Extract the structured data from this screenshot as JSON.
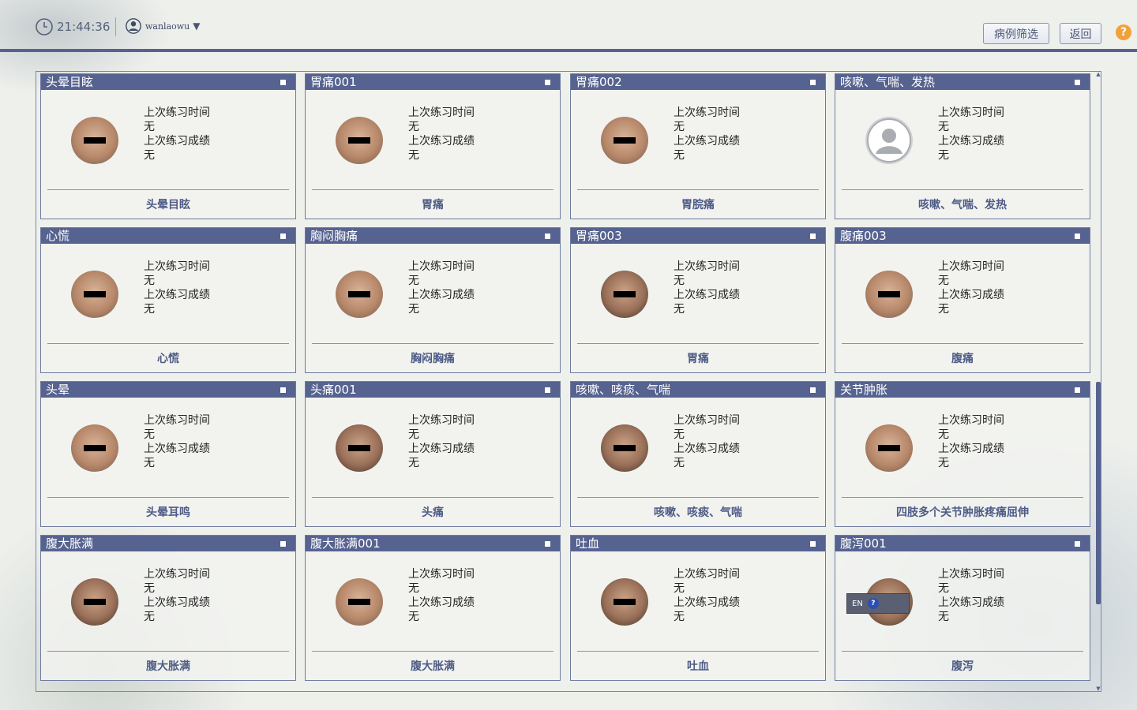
{
  "header": {
    "time": "21:44:36",
    "username": "wanlaowu",
    "filter_button": "病例筛选",
    "back_button": "返回",
    "help_label": "?"
  },
  "info_labels": {
    "last_time_label": "上次练习时间",
    "last_score_label": "上次练习成绩"
  },
  "cards": [
    {
      "title": "头晕目眩",
      "last_time": "无",
      "last_score": "无",
      "footer": "头晕目眩"
    },
    {
      "title": "胃痛001",
      "last_time": "无",
      "last_score": "无",
      "footer": "胃痛"
    },
    {
      "title": "胃痛002",
      "last_time": "无",
      "last_score": "无",
      "footer": "胃脘痛"
    },
    {
      "title": "咳嗽、气喘、发热",
      "last_time": "无",
      "last_score": "无",
      "footer": "咳嗽、气喘、发热"
    },
    {
      "title": "心慌",
      "last_time": "无",
      "last_score": "无",
      "footer": "心慌"
    },
    {
      "title": "胸闷胸痛",
      "last_time": "无",
      "last_score": "无",
      "footer": "胸闷胸痛"
    },
    {
      "title": "胃痛003",
      "last_time": "无",
      "last_score": "无",
      "footer": "胃痛"
    },
    {
      "title": "腹痛003",
      "last_time": "无",
      "last_score": "无",
      "footer": "腹痛"
    },
    {
      "title": "头晕",
      "last_time": "无",
      "last_score": "无",
      "footer": "头晕耳鸣"
    },
    {
      "title": "头痛001",
      "last_time": "无",
      "last_score": "无",
      "footer": "头痛"
    },
    {
      "title": "咳嗽、咳痰、气喘",
      "last_time": "无",
      "last_score": "无",
      "footer": "咳嗽、咳痰、气喘"
    },
    {
      "title": "关节肿胀",
      "last_time": "无",
      "last_score": "无",
      "footer": "四肢多个关节肿胀疼痛屈伸"
    },
    {
      "title": "腹大胀满",
      "last_time": "无",
      "last_score": "无",
      "footer": "腹大胀满"
    },
    {
      "title": "腹大胀满001",
      "last_time": "无",
      "last_score": "无",
      "footer": "腹大胀满"
    },
    {
      "title": "吐血",
      "last_time": "无",
      "last_score": "无",
      "footer": "吐血"
    },
    {
      "title": "腹泻001",
      "last_time": "无",
      "last_score": "无",
      "footer": "腹泻"
    }
  ],
  "ime_label": "EN",
  "colors": {
    "accent": "#56628f",
    "background": "#eef0ec"
  }
}
